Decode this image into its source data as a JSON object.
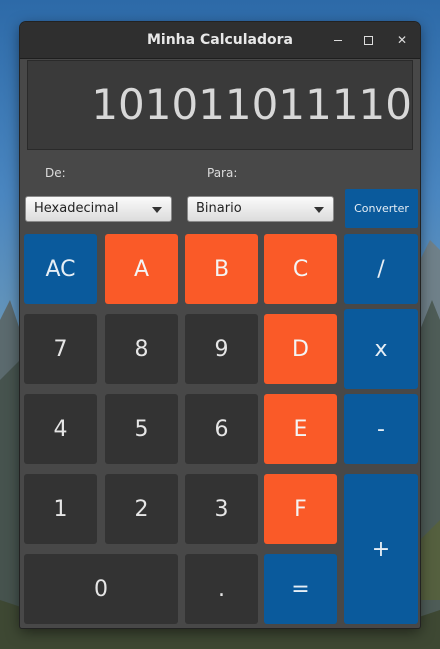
{
  "window": {
    "title": "Minha Calculadora"
  },
  "display": {
    "value": "101011011110"
  },
  "converter": {
    "from_label": "De:",
    "to_label": "Para:",
    "from_value": "Hexadecimal",
    "to_value": "Binario",
    "button_label": "Converter"
  },
  "keys": {
    "ac": "AC",
    "a": "A",
    "b": "B",
    "c": "C",
    "div": "/",
    "k7": "7",
    "k8": "8",
    "k9": "9",
    "d": "D",
    "mul": "x",
    "k4": "4",
    "k5": "5",
    "k6": "6",
    "e": "E",
    "sub": "-",
    "k1": "1",
    "k2": "2",
    "k3": "3",
    "f": "F",
    "add": "+",
    "k0": "0",
    "dot": ".",
    "eq": "="
  },
  "colors": {
    "orange": "#fa5a28",
    "blue": "#0a5a9c",
    "dark": "#333333"
  }
}
